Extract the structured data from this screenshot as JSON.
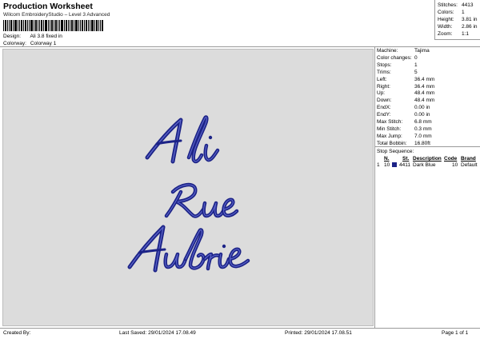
{
  "header": {
    "title": "Production Worksheet",
    "subtitle": "Wilcom EmbroideryStudio – Level 3 Advanced"
  },
  "meta": [
    {
      "key": "Design:",
      "value": "Ali 3.8 fixed in"
    },
    {
      "key": "Colorway:",
      "value": "Colorway 1"
    }
  ],
  "stats": [
    {
      "key": "Stitches:",
      "value": "4413"
    },
    {
      "key": "Colors:",
      "value": "1"
    },
    {
      "key": "Height:",
      "value": "3.81 in"
    },
    {
      "key": "Width:",
      "value": "2.86 in"
    },
    {
      "key": "Zoom:",
      "value": "1:1"
    }
  ],
  "design": {
    "lines": [
      "Ali",
      "Rue",
      "Aubrie"
    ],
    "thread_color": "#1c2387"
  },
  "machine_info": [
    {
      "key": "Machine:",
      "value": "Tajima"
    },
    {
      "key": "Color changes:",
      "value": "0"
    },
    {
      "key": "Stops:",
      "value": "1"
    },
    {
      "key": "Trims:",
      "value": "5"
    },
    {
      "key": "Left:",
      "value": "36.4 mm"
    },
    {
      "key": "Right:",
      "value": "36.4 mm"
    },
    {
      "key": "Up:",
      "value": "48.4 mm"
    },
    {
      "key": "Down:",
      "value": "48.4 mm"
    },
    {
      "key": "EndX:",
      "value": "0.00 in"
    },
    {
      "key": "EndY:",
      "value": "0.00 in"
    },
    {
      "key": "Max Stitch:",
      "value": "6.8 mm"
    },
    {
      "key": "Min Stitch:",
      "value": "0.3 mm"
    },
    {
      "key": "Max Jump:",
      "value": "7.0 mm"
    },
    {
      "key": "Total Bobbin:",
      "value": "16.80ft"
    }
  ],
  "stop_sequence": {
    "label": "Stop Sequence:",
    "columns": [
      "N.",
      "St.",
      "Description",
      "Code",
      "Brand"
    ],
    "rows": [
      {
        "index": "1",
        "n": "10",
        "st": "4411",
        "description": "Dark Blue",
        "code": "10",
        "brand": "Default",
        "color": "#1c2387"
      }
    ]
  },
  "footer": {
    "created_by": "Created By:",
    "last_saved": "Last Saved: 29/01/2024 17.08.49",
    "printed": "Printed: 29/01/2024 17.08.51",
    "page": "Page 1 of 1"
  }
}
